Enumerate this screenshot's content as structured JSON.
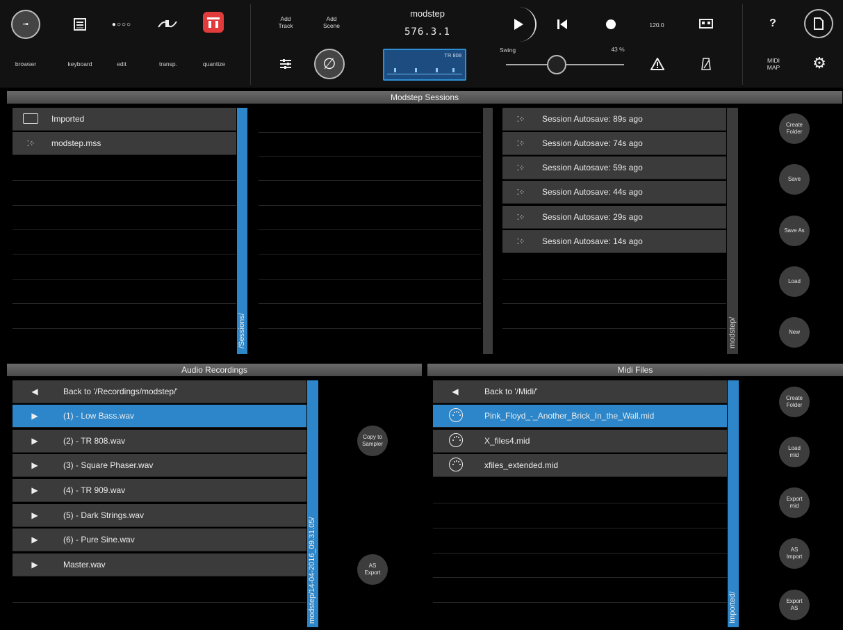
{
  "toolbar": {
    "browser_label": "browser",
    "keyboard_label": "keyboard",
    "edit_label": "edit",
    "transp_label": "transp.",
    "quantize_label": "quantize",
    "add_track_label": "Add\nTrack",
    "add_scene_label": "Add\nScene",
    "title": "modstep",
    "position": "576.3.1",
    "display_label": "TR 808",
    "tempo": "120.0",
    "swing_label": "Swing",
    "swing_value": "43 %",
    "help_label": "?",
    "midi_map_label": "MIDI\nMAP",
    "accent_color": "#2d86c9",
    "quantize_color": "#e23b3b"
  },
  "sessions": {
    "header": "Modstep Sessions",
    "left_items": [
      {
        "icon": "folder-icon",
        "label": "Imported"
      },
      {
        "icon": "session-icon",
        "label": "modstep.mss"
      }
    ],
    "left_path": "/Sessions/",
    "right_items": [
      {
        "icon": "session-icon",
        "label": "Session Autosave: 89s ago"
      },
      {
        "icon": "session-icon",
        "label": "Session Autosave: 74s ago"
      },
      {
        "icon": "session-icon",
        "label": "Session Autosave: 59s ago"
      },
      {
        "icon": "session-icon",
        "label": "Session Autosave: 44s ago"
      },
      {
        "icon": "session-icon",
        "label": "Session Autosave: 29s ago"
      },
      {
        "icon": "session-icon",
        "label": "Session Autosave: 14s ago"
      }
    ],
    "right_path": "modstep/",
    "buttons": {
      "create_folder": "Create\nFolder",
      "save": "Save",
      "save_as": "Save As",
      "load": "Load",
      "new": "New"
    }
  },
  "audio": {
    "header": "Audio Recordings",
    "items": [
      {
        "icon": "back-arrow-icon",
        "label": "Back to '/Recordings/modstep/'",
        "selected": false
      },
      {
        "icon": "play-icon",
        "label": "(1) - Low Bass.wav",
        "selected": true
      },
      {
        "icon": "play-icon",
        "label": "(2) - TR 808.wav",
        "selected": false
      },
      {
        "icon": "play-icon",
        "label": "(3) - Square Phaser.wav",
        "selected": false
      },
      {
        "icon": "play-icon",
        "label": "(4) - TR 909.wav",
        "selected": false
      },
      {
        "icon": "play-icon",
        "label": "(5) - Dark Strings.wav",
        "selected": false
      },
      {
        "icon": "play-icon",
        "label": "(6) - Pure Sine.wav",
        "selected": false
      },
      {
        "icon": "play-icon",
        "label": "Master.wav",
        "selected": false
      }
    ],
    "path": "modstep/14-04-2016_09.31.05/",
    "buttons": {
      "copy_to_sampler": "Copy to\nSampler",
      "as_export": "AS\nExport"
    }
  },
  "midi": {
    "header": "Midi Files",
    "items": [
      {
        "icon": "back-arrow-icon",
        "label": "Back to '/Midi/'",
        "selected": false
      },
      {
        "icon": "midi-file-icon",
        "label": "Pink_Floyd_-_Another_Brick_In_the_Wall.mid",
        "selected": true
      },
      {
        "icon": "midi-file-icon",
        "label": "X_files4.mid",
        "selected": false
      },
      {
        "icon": "midi-file-icon",
        "label": "xfiles_extended.mid",
        "selected": false
      }
    ],
    "path": "Imported/",
    "buttons": {
      "create_folder": "Create\nFolder",
      "load_mid": "Load\nmid",
      "export_mid": "Export\nmid",
      "as_import": "AS\nImport",
      "export_as": "Export\nAS"
    }
  }
}
